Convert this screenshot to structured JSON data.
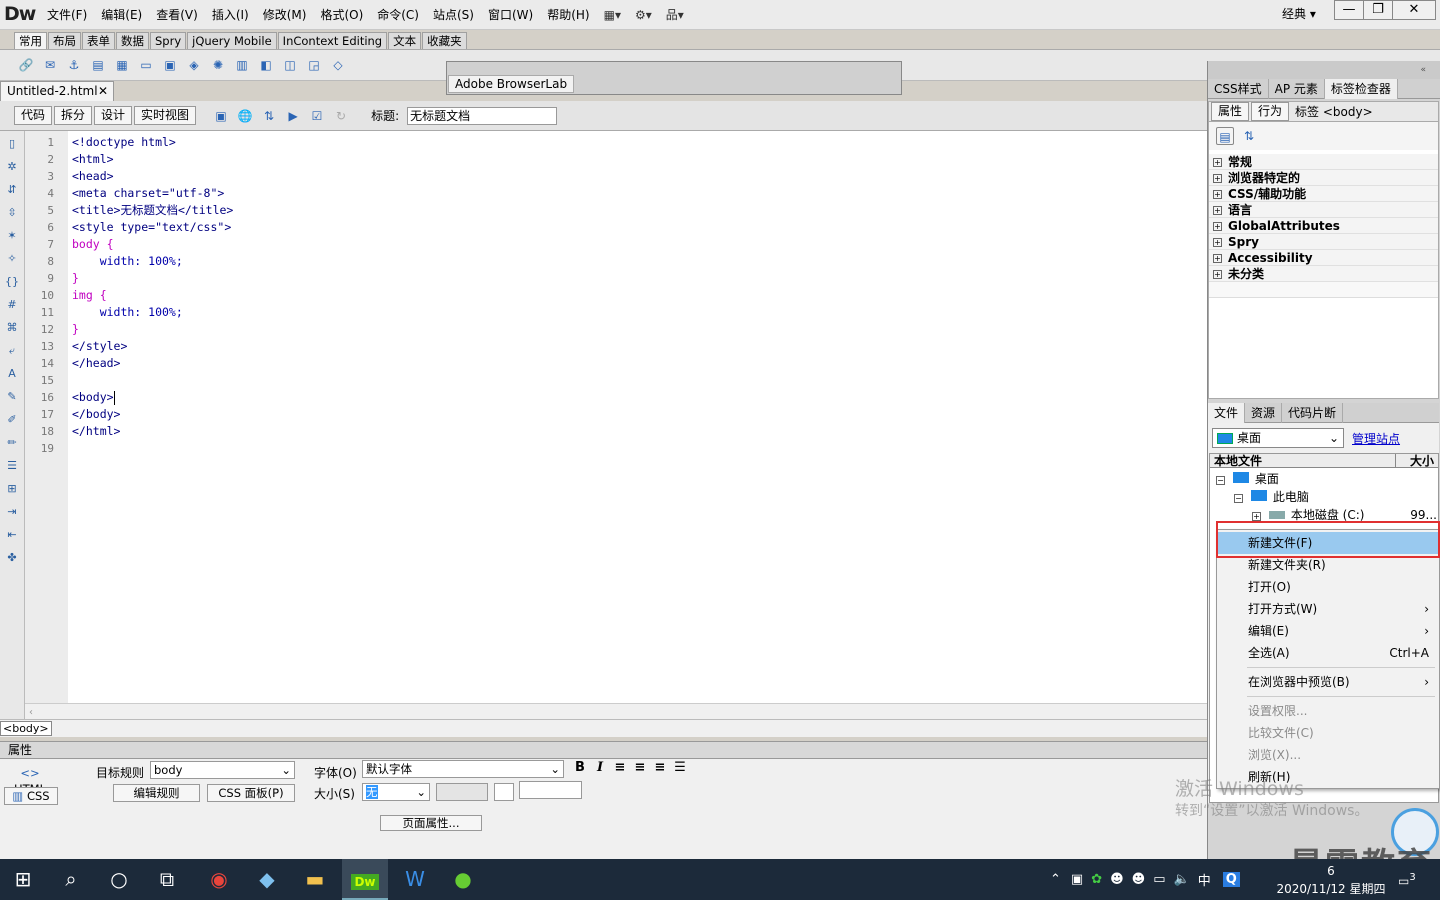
{
  "app": {
    "logo": "Dw",
    "layout_label": "经典 ▾"
  },
  "menu": [
    "文件(F)",
    "编辑(E)",
    "查看(V)",
    "插入(I)",
    "修改(M)",
    "格式(O)",
    "命令(C)",
    "站点(S)",
    "窗口(W)",
    "帮助(H)"
  ],
  "insert_tabs": [
    "常用",
    "布局",
    "表单",
    "数据",
    "Spry",
    "jQuery Mobile",
    "InContext Editing",
    "文本",
    "收藏夹"
  ],
  "browserlab": {
    "title": "Adobe BrowserLab"
  },
  "document": {
    "tab_name": "Untitled-2.html",
    "views": [
      "代码",
      "拆分",
      "设计",
      "实时视图"
    ],
    "title_label": "标题:",
    "title_value": "无标题文档",
    "tag_selector": "<body>"
  },
  "code_lines": [
    "<!doctype html>",
    "<html>",
    "<head>",
    "<meta charset=\"utf-8\">",
    "<title>无标题文档</title>",
    "<style type=\"text/css\">",
    "body {",
    "    width: 100%;",
    "}",
    "img {",
    "    width: 100%;",
    "}",
    "</style>",
    "</head>",
    "",
    "<body>",
    "</body>",
    "</html>",
    ""
  ],
  "properties": {
    "header": "属性",
    "html_btn": "HTML",
    "css_btn": "CSS",
    "target_rule_label": "目标规则",
    "target_rule_value": "body",
    "edit_rule": "编辑规则",
    "css_panel": "CSS 面板(P)",
    "font_label": "字体(O)",
    "font_value": "默认字体",
    "size_label": "大小(S)",
    "size_value": "无",
    "page_props": "页面属性..."
  },
  "right_panel": {
    "top_tabs": [
      "CSS样式",
      "AP 元素",
      "标签检查器"
    ],
    "sub_tabs": [
      "属性",
      "行为"
    ],
    "tag_label": "标签 <body>",
    "categories": [
      "常规",
      "浏览器特定的",
      "CSS/辅助功能",
      "语言",
      "GlobalAttributes",
      "Spry",
      "Accessibility",
      "未分类"
    ],
    "files_tabs": [
      "文件",
      "资源",
      "代码片断"
    ],
    "site": "桌面",
    "manage_site": "管理站点",
    "col_local": "本地文件",
    "col_size": "大小",
    "tree": [
      {
        "label": "桌面"
      },
      {
        "label": "此电脑"
      },
      {
        "label": "本地磁盘 (C:)",
        "size": "99..."
      }
    ]
  },
  "context_menu": [
    {
      "label": "新建文件(F)",
      "shortcut": "",
      "arrow": false,
      "disabled": false
    },
    {
      "label": "新建文件夹(R)",
      "shortcut": "",
      "arrow": false,
      "disabled": false
    },
    {
      "label": "打开(O)",
      "shortcut": "",
      "arrow": false,
      "disabled": false
    },
    {
      "label": "打开方式(W)",
      "shortcut": "›",
      "arrow": true,
      "disabled": false
    },
    {
      "label": "编辑(E)",
      "shortcut": "›",
      "arrow": true,
      "disabled": false
    },
    {
      "label": "全选(A)",
      "shortcut": "Ctrl+A",
      "arrow": false,
      "disabled": false
    },
    {
      "label": "在浏览器中预览(B)",
      "shortcut": "›",
      "arrow": true,
      "disabled": false
    },
    {
      "label": "设置权限...",
      "shortcut": "",
      "arrow": false,
      "disabled": true
    },
    {
      "label": "比较文件(C)",
      "shortcut": "",
      "arrow": false,
      "disabled": true
    },
    {
      "label": "浏览(X)...",
      "shortcut": "",
      "arrow": false,
      "disabled": true
    },
    {
      "label": "刷新(H)",
      "shortcut": "",
      "arrow": false,
      "disabled": false
    }
  ],
  "watermark": {
    "line1": "激活 Windows",
    "line2": "转到“设置”以激活 Windows。",
    "brand": "最需教育"
  },
  "taskbar": {
    "time": "6",
    "date": "2020/11/12 星期四",
    "ime": "中",
    "notif": "3"
  },
  "colors": {
    "highlight": "#e03030",
    "menu_hover": "#99c9ef",
    "accent": "#2a64b4"
  }
}
